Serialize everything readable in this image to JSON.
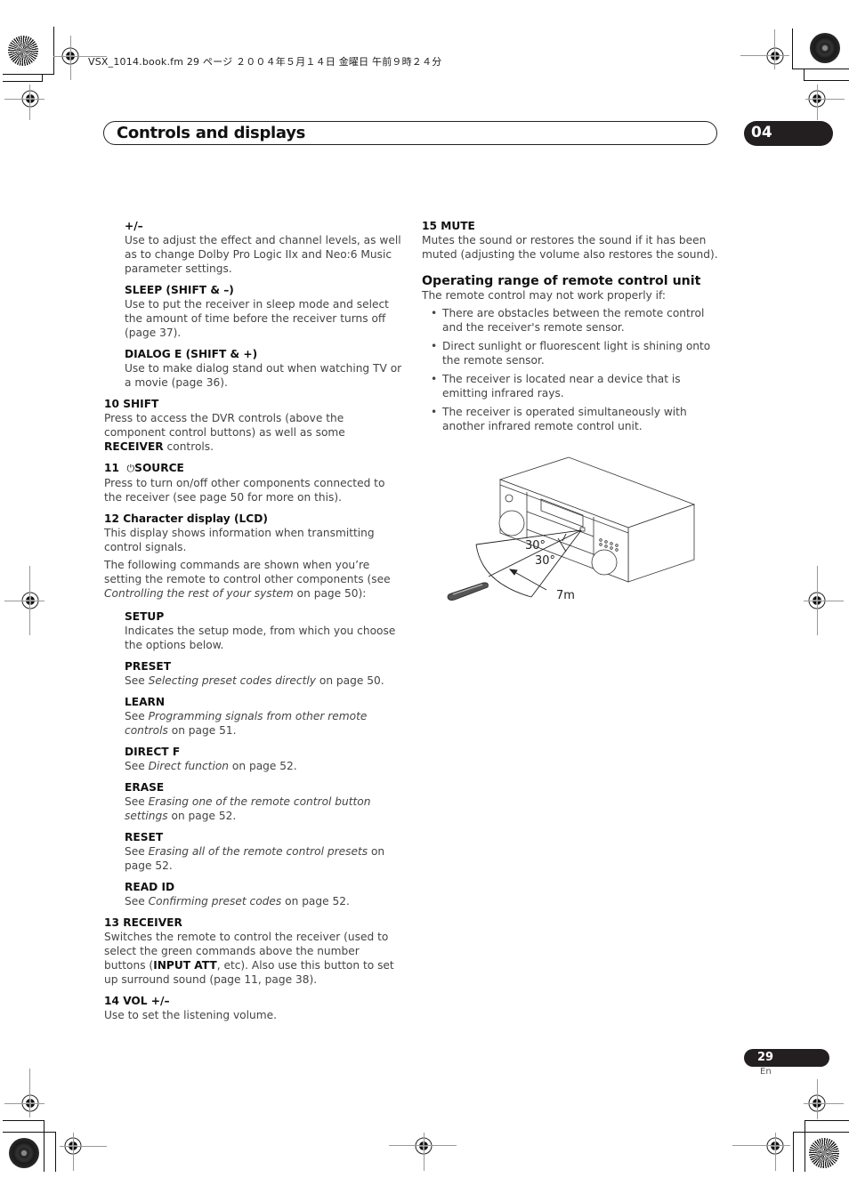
{
  "print_header": {
    "file_info": "VSX_1014.book.fm  29 ページ  ２００４年５月１４日  金曜日  午前９時２４分"
  },
  "title_bar": {
    "title": "Controls and displays",
    "chapter_number": "04"
  },
  "left_column": {
    "plus_minus": {
      "heading": "+/–",
      "body": "Use to adjust the effect and channel levels, as well as to change Dolby Pro Logic IIx and Neo:6 Music parameter settings."
    },
    "sleep": {
      "heading": "SLEEP (SHIFT & –)",
      "body": "Use to put the receiver in sleep mode and select the amount of time before the receiver turns off (page 37)."
    },
    "dialog_e": {
      "heading": "DIALOG E (SHIFT & +)",
      "body": "Use to make dialog stand out when watching TV or a movie (page 36)."
    },
    "item10": {
      "heading": "10  SHIFT",
      "body_pre": "Press to access the DVR controls (above the component control buttons) as well as some ",
      "body_bold": "RECEIVER",
      "body_post": " controls."
    },
    "item11": {
      "number": "11",
      "icon": "power-icon",
      "icon_glyph": "⏻",
      "heading": "SOURCE",
      "body": "Press to turn on/off other components connected to the receiver (see page 50 for more on this)."
    },
    "item12": {
      "heading": "12  Character display (LCD)",
      "body1": "This display shows information when transmitting control signals.",
      "body2_pre": "The following commands are shown when you’re setting the remote to control other components (see ",
      "body2_italic": "Controlling the rest of your system",
      "body2_post": " on page 50):"
    },
    "commands": [
      {
        "heading": "SETUP",
        "pre": "Indicates the setup mode, from which you choose the options below.",
        "italic": "",
        "post": ""
      },
      {
        "heading": "PRESET",
        "pre": "See ",
        "italic": "Selecting preset codes directly",
        "post": " on page 50."
      },
      {
        "heading": "LEARN",
        "pre": "See ",
        "italic": "Programming signals from other remote controls",
        "post": " on page 51."
      },
      {
        "heading": "DIRECT F",
        "pre": "See ",
        "italic": "Direct function",
        "post": " on page 52."
      },
      {
        "heading": "ERASE",
        "pre": "See ",
        "italic": "Erasing one of the remote control button settings",
        "post": " on page 52."
      },
      {
        "heading": "RESET",
        "pre": "See ",
        "italic": "Erasing all of the remote control presets",
        "post": " on page 52."
      },
      {
        "heading": "READ ID",
        "pre": "See ",
        "italic": "Confirming preset codes",
        "post": " on page 52."
      }
    ],
    "item13": {
      "heading": "13  RECEIVER",
      "body_pre": "Switches the remote to control the receiver (used to select the green commands above the number buttons (",
      "body_bold": "INPUT ATT",
      "body_post": ", etc). Also use this button to set up surround sound (page 11, page 38)."
    },
    "item14": {
      "heading": "14  VOL +/–",
      "body": "Use to set the listening volume."
    }
  },
  "right_column": {
    "item15": {
      "heading": "15  MUTE",
      "body": "Mutes the sound or restores the sound if it has been muted (adjusting the volume also restores the sound)."
    },
    "operating_range": {
      "title": "Operating range of remote control unit",
      "intro": "The remote control may not work properly if:",
      "bullets": [
        "There are obstacles between the remote control and the receiver's remote sensor.",
        "Direct sunlight or fluorescent light is shining onto the remote sensor.",
        "The receiver is located near a device that is emitting infrared rays.",
        "The receiver is operated simultaneously with another infrared remote control unit."
      ]
    },
    "diagram": {
      "angle_upper": "30°",
      "angle_lower": "30°",
      "distance": "7m"
    }
  },
  "footer": {
    "page_number": "29",
    "language": "En"
  }
}
